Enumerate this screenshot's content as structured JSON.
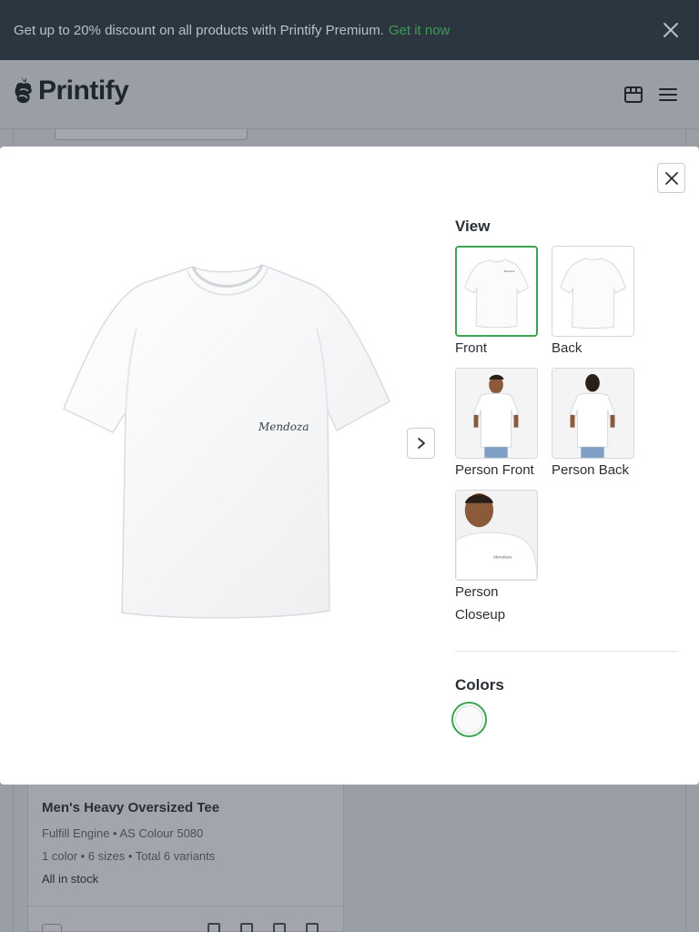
{
  "banner": {
    "text": "Get up to 20% discount on all products with Printify Premium.",
    "link": "Get it now"
  },
  "header": {
    "brand": "Printify"
  },
  "modal": {
    "view_title": "View",
    "views": [
      {
        "label": "Front",
        "selected": true
      },
      {
        "label": "Back",
        "selected": false
      },
      {
        "label": "Person Front",
        "selected": false
      },
      {
        "label": "Person Back",
        "selected": false
      },
      {
        "label": "Person Closeup",
        "label_line1": "Person",
        "label_line2": "Closeup",
        "selected": false
      }
    ],
    "colors_title": "Colors",
    "colors": [
      {
        "hex": "#fafafa",
        "selected": true
      }
    ],
    "shirt_print": "Mendoza"
  },
  "background_card": {
    "title": "Men's Heavy Oversized Tee",
    "provider": "Fulfill Engine • AS Colour 5080",
    "variants": "1 color • 6 sizes • Total 6 variants",
    "stock": "All in stock"
  },
  "colors": {
    "banner_bg": "#2b3641",
    "accent_green": "#3ca34f",
    "overlay": "#9a9ea5"
  }
}
